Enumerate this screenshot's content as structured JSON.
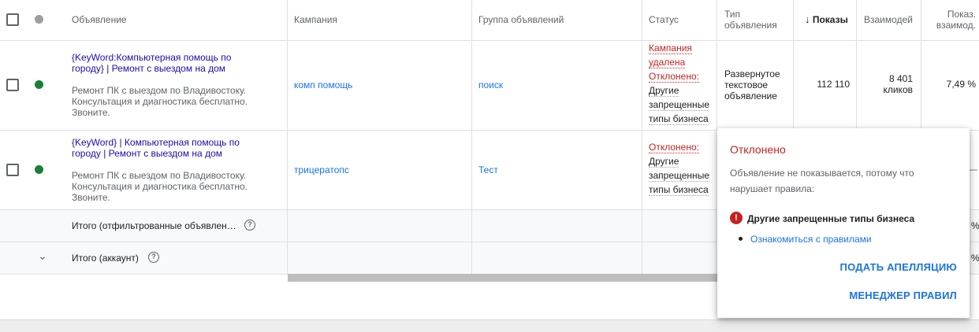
{
  "header": {
    "ad": "Объявление",
    "campaign": "Кампания",
    "adgroup": "Группа объявлений",
    "status": "Статус",
    "type_line1": "Тип",
    "type_line2": "объявления",
    "impressions_arrow": "↓",
    "impressions": "Показы",
    "interactions": "Взаимодей",
    "rate_line1": "Показ.",
    "rate_line2": "взаимод."
  },
  "rows": [
    {
      "headline_line1": "{KeyWord:Компьютерная помощь по",
      "headline_line2": "городу} | Ремонт с выездом на дом",
      "desc_line1": "Ремонт ПК с выездом по Владивостоку.",
      "desc_line2": "Консультация и диагностика бесплатно.",
      "desc_line3": "Звоните.",
      "campaign": "комп помощь",
      "adgroup": "поиск",
      "status_a1": "Кампания",
      "status_a2": "удалена",
      "status_b": "Отклонено:",
      "status_c1": "Другие",
      "status_c2": "запрещенные",
      "status_c3": "типы бизнеса",
      "type_line1": "Развернутое",
      "type_line2": "текстовое",
      "type_line3": "объявление",
      "impressions": "112 110",
      "interactions_line1": "8 401",
      "interactions_line2": "кликов",
      "rate": "7,49 %",
      "status_color": "#188038"
    },
    {
      "headline_line1": "{KeyWord} | Компьютерная помощь по",
      "headline_line2": "городу | Ремонт с выездом на дом",
      "desc_line1": "Ремонт ПК с выездом по Владивостоку.",
      "desc_line2": "Консультация и диагностика бесплатно.",
      "desc_line3": "Звоните.",
      "campaign": "трицератопс",
      "adgroup": "Тест",
      "status_b": "Отклонено:",
      "status_c1": "Другие",
      "status_c2": "запрещенные",
      "status_c3": "типы бизнеса",
      "rate_partial": "—",
      "status_color": "#188038"
    }
  ],
  "totals": {
    "filtered": "Итого (отфильтрованные объявлен…",
    "account": "Итого (аккаунт)",
    "help_glyph": "?",
    "partial_percent": "%"
  },
  "popup": {
    "title": "Отклонено",
    "description": "Объявление не показывается, потому что нарушает правила:",
    "error_glyph": "!",
    "reason": "Другие запрещенные типы бизнеса",
    "policy_link": "Ознакомиться с правилами",
    "appeal_button": "ПОДАТЬ АПЕЛЛЯЦИЮ",
    "policy_manager_button": "МЕНЕДЖЕР ПРАВИЛ"
  },
  "colors": {
    "link": "#1a73e8",
    "headline": "#1a0dab",
    "error": "#c5221f",
    "enabled": "#188038"
  }
}
